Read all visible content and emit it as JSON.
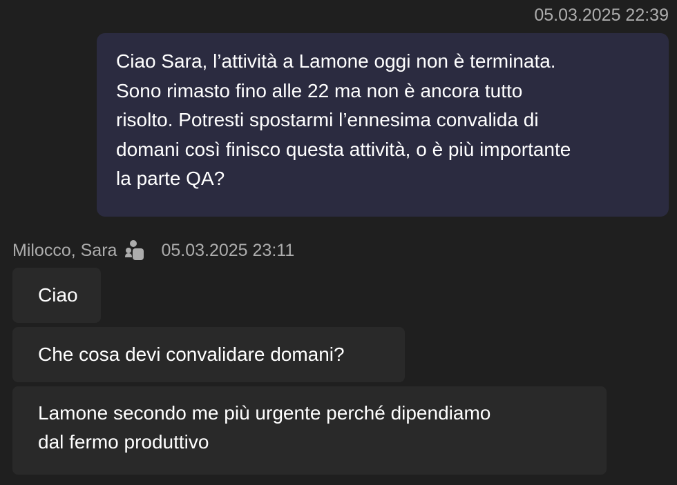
{
  "outgoing": {
    "timestamp": "05.03.2025 22:39",
    "text": "Ciao Sara, l’attività a Lamone oggi non è terminata.\nSono rimasto fino alle 22 ma non è ancora tutto\nrisolto. Potresti spostarmi l’ennesima convalida di\ndomani così finisco questa attività, o è più importante\nla parte QA?"
  },
  "incoming": {
    "sender": "Milocco, Sara",
    "status_icon": "group-chat-icon",
    "timestamp": "05.03.2025 23:11",
    "messages": [
      "Ciao",
      "Che cosa devi convalidare domani?",
      "Lamone secondo me più urgente perché dipendiamo\ndal fermo produttivo"
    ]
  },
  "colors": {
    "background": "#1f1f1f",
    "outgoing_bubble": "#2b2b40",
    "incoming_bubble": "#292929",
    "meta_text": "#adadad"
  }
}
